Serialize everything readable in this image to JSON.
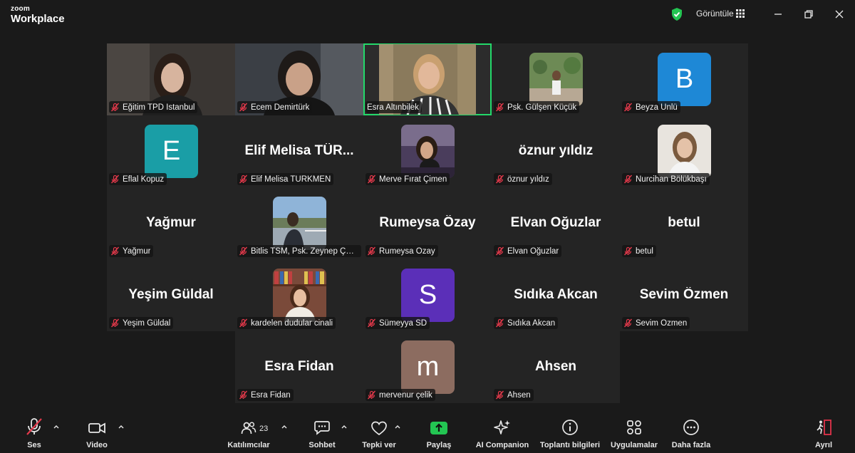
{
  "app": {
    "brand_small": "zoom",
    "brand": "Workplace"
  },
  "titlebar": {
    "view_label": "Görüntüle"
  },
  "participants": [
    {
      "label": "Eğitim TPD İstanbul",
      "kind": "video"
    },
    {
      "label": "Ecem Demirtürk",
      "kind": "video"
    },
    {
      "label": "Esra Altınbilek",
      "kind": "video",
      "active_speaker": true
    },
    {
      "label": "Psk. Gülşen Küçük",
      "kind": "photo"
    },
    {
      "label": "Beyza Ünlü",
      "kind": "initial",
      "initial": "B",
      "color": "#1e88d6"
    },
    {
      "label": "Eflal Kopuz",
      "kind": "initial",
      "initial": "E",
      "color": "#1a9ea6"
    },
    {
      "label": "Elif Melisa TÜRKMEN",
      "kind": "name",
      "display": "Elif Melisa TÜR..."
    },
    {
      "label": "Merve Fırat Çimen",
      "kind": "photo"
    },
    {
      "label": "öznur yıldız",
      "kind": "name",
      "display": "öznur yıldız"
    },
    {
      "label": "Nurcihan Bölükbaşı",
      "kind": "photo"
    },
    {
      "label": "Yağmur",
      "kind": "name",
      "display": "Yağmur"
    },
    {
      "label": "Bitlis TSM, Psk. Zeynep Çağl...",
      "kind": "photo"
    },
    {
      "label": "Rumeysa Özay",
      "kind": "name",
      "display": "Rumeysa Özay"
    },
    {
      "label": "Elvan Oğuzlar",
      "kind": "name",
      "display": "Elvan Oğuzlar"
    },
    {
      "label": "betul",
      "kind": "name",
      "display": "betul"
    },
    {
      "label": "Yeşim Güldal",
      "kind": "name",
      "display": "Yeşim Güldal"
    },
    {
      "label": "kardelen dudular cinali",
      "kind": "photo"
    },
    {
      "label": "Sümeyya SD",
      "kind": "initial",
      "initial": "S",
      "color": "#5b2fb8"
    },
    {
      "label": "Sıdıka Akcan",
      "kind": "name",
      "display": "Sıdıka Akcan"
    },
    {
      "label": "Sevim Özmen",
      "kind": "name",
      "display": "Sevim Özmen"
    },
    {
      "label": "Esra Fidan",
      "kind": "name",
      "display": "Esra Fidan"
    },
    {
      "label": "mervenur çelik",
      "kind": "initial",
      "initial": "m",
      "color": "#8c6c60"
    },
    {
      "label": "Ahsen",
      "kind": "name",
      "display": "Ahsen"
    }
  ],
  "toolbar": {
    "audio": "Ses",
    "video": "Video",
    "participants": "Katılımcılar",
    "participants_count": "23",
    "chat": "Sohbet",
    "reactions": "Tepki ver",
    "share": "Paylaş",
    "ai": "AI Companion",
    "info": "Toplantı bilgileri",
    "apps": "Uygulamalar",
    "more": "Daha fazla",
    "leave": "Ayrıl"
  },
  "colors": {
    "active_border": "#23d96a",
    "share_green": "#23c552",
    "leave_red": "#e0334a",
    "muted_red": "#e5394b"
  }
}
